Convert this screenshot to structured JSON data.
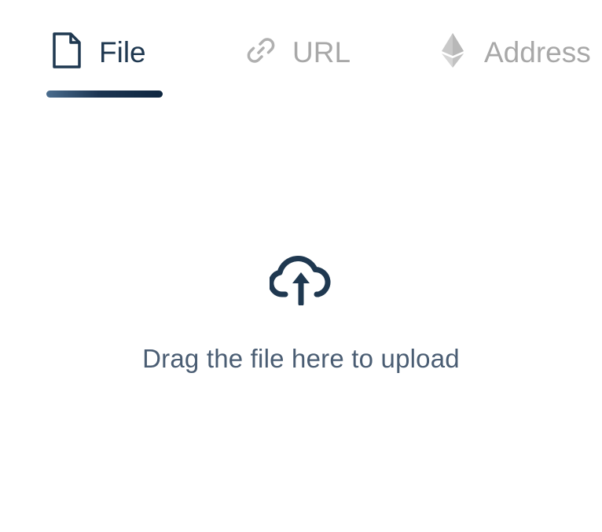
{
  "tabs": [
    {
      "label": "File",
      "icon": "file-icon",
      "active": true
    },
    {
      "label": "URL",
      "icon": "link-icon",
      "active": false
    },
    {
      "label": "Address",
      "icon": "ethereum-icon",
      "active": false
    }
  ],
  "dropzone": {
    "icon": "cloud-upload-icon",
    "hint": "Drag the file here to upload"
  },
  "colors": {
    "active_text": "#1f3850",
    "inactive_text": "#a8a8a8",
    "hint_text": "#4a5d73",
    "underline_start": "#4a6d8e",
    "underline_end": "#0f2741"
  }
}
